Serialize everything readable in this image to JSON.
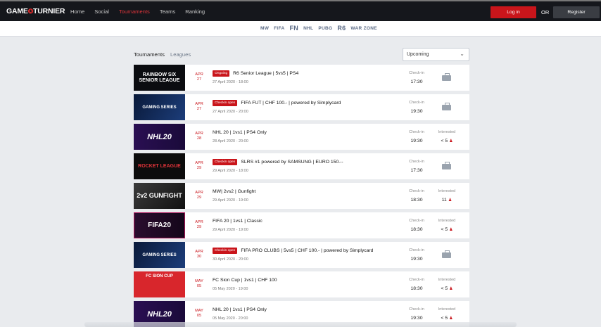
{
  "brand": {
    "logo_text": "GAME",
    "logo_mark": "✪",
    "logo_text2": "TURNIER"
  },
  "nav": {
    "items": [
      {
        "label": "Home"
      },
      {
        "label": "Social"
      },
      {
        "label": "Tournaments"
      },
      {
        "label": "Teams"
      },
      {
        "label": "Ranking"
      }
    ]
  },
  "auth": {
    "login_label": "Log in",
    "or_label": "OR",
    "register_label": "Register"
  },
  "games": [
    "MW",
    "FIFA",
    "FN",
    "NHL",
    "PUBG",
    "R6",
    "WAR ZONE"
  ],
  "tabs": {
    "tournaments": "Tournaments",
    "leagues": "Leagues"
  },
  "filter": {
    "selected": "Upcoming"
  },
  "colors": {
    "accent": "#c9151b",
    "topbar": "#15171c"
  },
  "tournaments": [
    {
      "thumb": "RAINBOW SIX SENIOR LEAGUE",
      "month": "APR",
      "day": "27",
      "badge": "Ongoing",
      "title": "R6 Senior League | 5vs5 | PS4",
      "date": "27 April 2020 - 18:00",
      "checkin_label": "Check-in",
      "checkin_time": "17:30",
      "icon": "bag-icon"
    },
    {
      "thumb": "GAMING SERIES",
      "month": "APR",
      "day": "27",
      "badge": "Checkin open",
      "title": "FIFA FUT | CHF 100.- | powered by Simplycard",
      "date": "27 April 2020 - 20:00",
      "checkin_label": "Check-in",
      "checkin_time": "19:30",
      "icon": "bag-icon"
    },
    {
      "thumb": "NHL20",
      "month": "APR",
      "day": "28",
      "badge": "",
      "title": "NHL 20 | 1vs1 | PS4 Only",
      "date": "28 April 2020 - 20:00",
      "checkin_label": "Check-in",
      "checkin_time": "19:30",
      "interested_label": "Interested",
      "interested_value": "< 5"
    },
    {
      "thumb": "ROCKET LEAGUE",
      "month": "APR",
      "day": "29",
      "badge": "Checkin open",
      "title": "SLRS #1 powered by SAMSUNG | EURO 150.--",
      "date": "29 April 2020 - 18:00",
      "checkin_label": "Check-in",
      "checkin_time": "17:30",
      "icon": "bag-icon"
    },
    {
      "thumb": "2v2 GUNFIGHT",
      "month": "APR",
      "day": "29",
      "badge": "",
      "title": "MW| 2vs2 | Gunfight",
      "date": "29 April 2020 - 19:00",
      "checkin_label": "Check-in",
      "checkin_time": "18:30",
      "interested_label": "Interested",
      "interested_value": "11"
    },
    {
      "thumb": "FIFA20",
      "month": "APR",
      "day": "29",
      "badge": "",
      "title": "FIFA 20 | 1vs1 | Classic",
      "date": "29 April 2020 - 19:00",
      "checkin_label": "Check-in",
      "checkin_time": "18:30",
      "interested_label": "Interested",
      "interested_value": "< 5"
    },
    {
      "thumb": "GAMING SERIES",
      "month": "APR",
      "day": "30",
      "badge": "Checkin open",
      "title": "FIFA PRO CLUBS | 5vs5 | CHF 100.- | powered by Simplycard",
      "date": "30 April 2020 - 20:00",
      "checkin_label": "Check-in",
      "checkin_time": "19:30",
      "icon": "bag-icon"
    },
    {
      "thumb": "FC SION CUP",
      "month": "MAY",
      "day": "05",
      "badge": "",
      "title": "FC Sion Cup | 1vs1 | CHF 100",
      "date": "05 May 2020 - 19:00",
      "checkin_label": "Check-in",
      "checkin_time": "18:30",
      "interested_label": "Interested",
      "interested_value": "< 5"
    },
    {
      "thumb": "NHL20",
      "month": "MAY",
      "day": "05",
      "badge": "",
      "title": "NHL 20 | 1vs1 | PS4 Only",
      "date": "05 May 2020 - 20:00",
      "checkin_label": "Check-in",
      "checkin_time": "19:30",
      "interested_label": "Interested",
      "interested_value": "< 5"
    }
  ]
}
